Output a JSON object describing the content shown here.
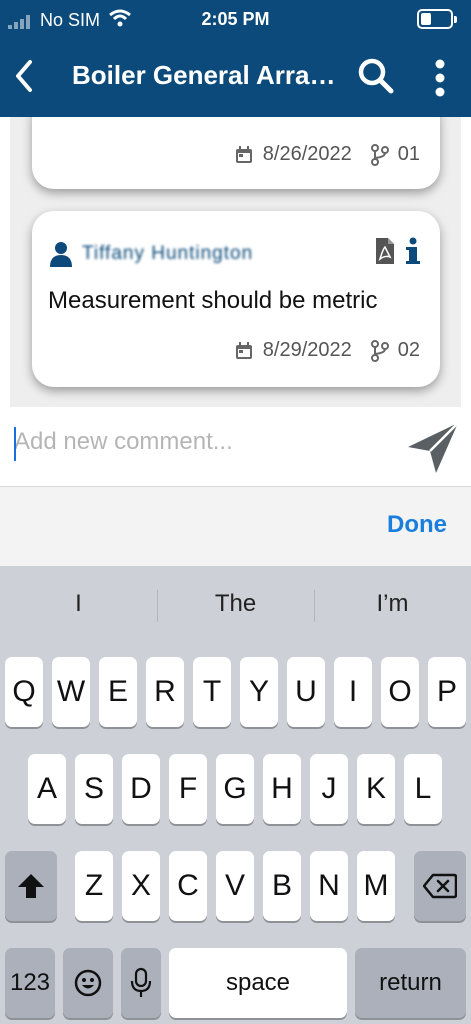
{
  "status_bar": {
    "carrier": "No SIM",
    "time": "2:05 PM"
  },
  "header": {
    "title": "Boiler General Arran..."
  },
  "comments": [
    {
      "date": "8/26/2022",
      "revision": "01"
    },
    {
      "author": "Tiffany Huntington",
      "text": "Measurement should be metric",
      "date": "8/29/2022",
      "revision": "02"
    }
  ],
  "comment_input": {
    "placeholder": "Add new comment...",
    "value": ""
  },
  "done_label": "Done",
  "suggestions": [
    "I",
    "The",
    "I’m"
  ],
  "keyboard": {
    "row1": [
      "Q",
      "W",
      "E",
      "R",
      "T",
      "Y",
      "U",
      "I",
      "O",
      "P"
    ],
    "row2": [
      "A",
      "S",
      "D",
      "F",
      "G",
      "H",
      "J",
      "K",
      "L"
    ],
    "row3": [
      "Z",
      "X",
      "C",
      "V",
      "B",
      "N",
      "M"
    ],
    "numbers_label": "123",
    "space_label": "space",
    "return_label": "return"
  },
  "colors": {
    "header_bg": "#0b4a7a",
    "accent": "#1a7fdc",
    "keyboard_bg": "#cdd0d6"
  }
}
